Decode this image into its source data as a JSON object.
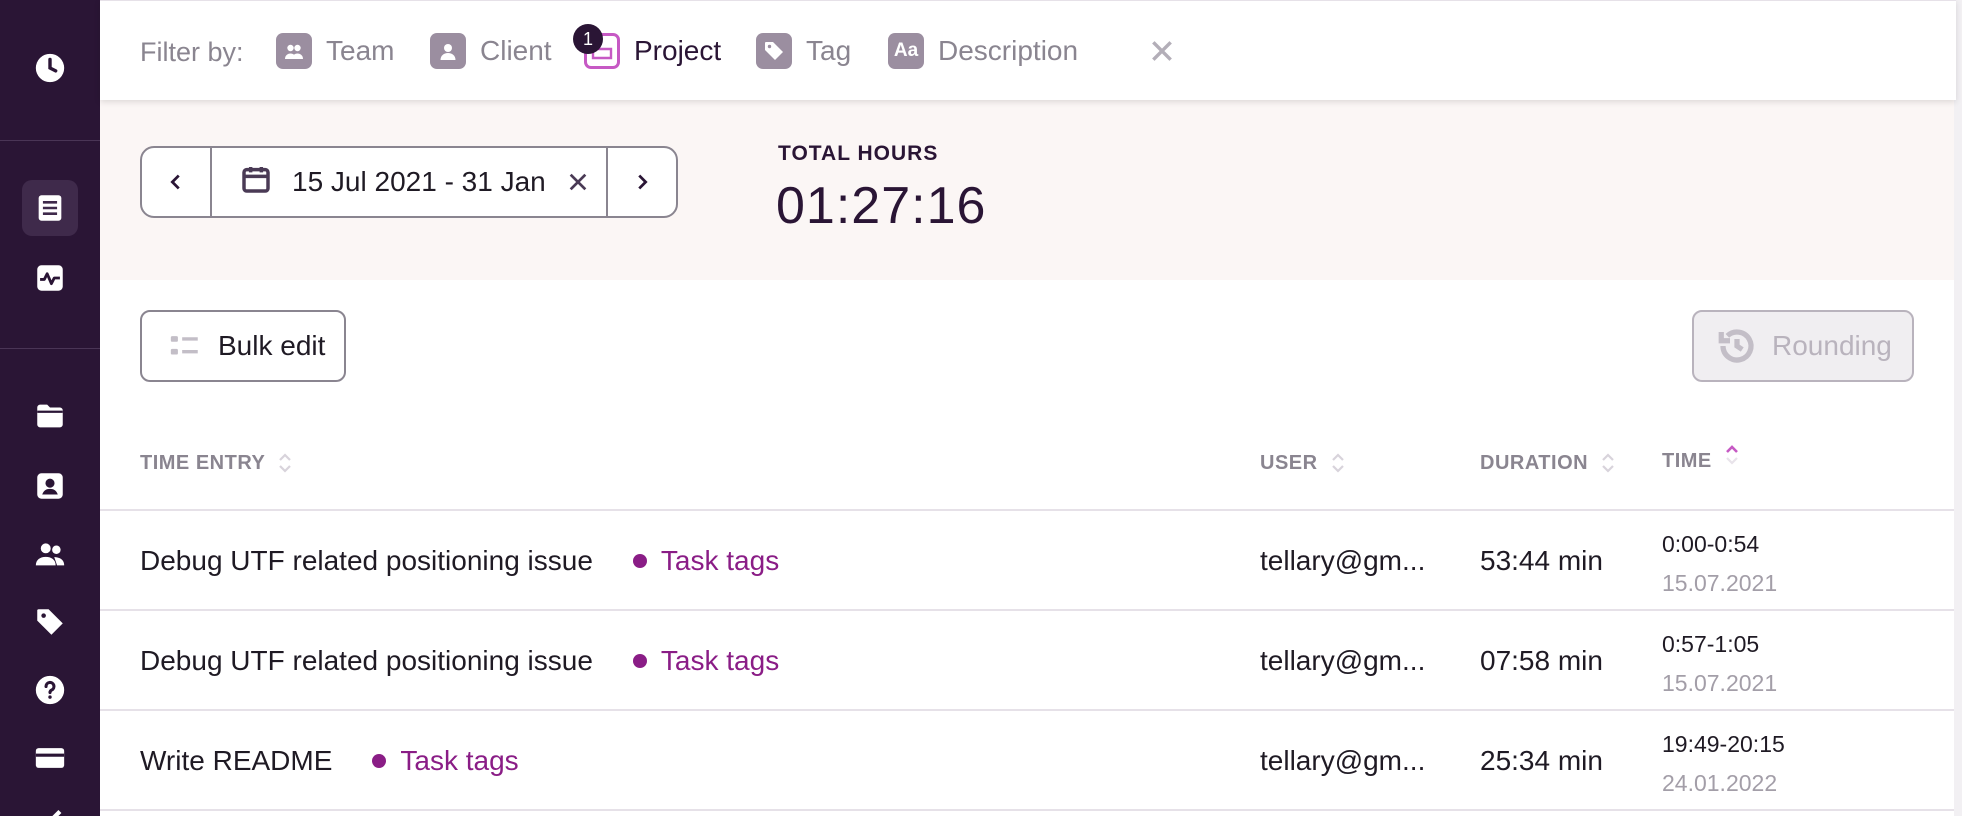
{
  "sidebar": {
    "items": [
      {
        "name": "clock-icon"
      },
      {
        "name": "timesheet-icon",
        "active": true
      },
      {
        "name": "activity-icon"
      },
      {
        "name": "folder-icon"
      },
      {
        "name": "client-icon"
      },
      {
        "name": "team-icon"
      },
      {
        "name": "tag-icon"
      },
      {
        "name": "help-icon"
      },
      {
        "name": "billing-icon"
      },
      {
        "name": "check-icon"
      }
    ]
  },
  "filters": {
    "label": "Filter by:",
    "items": [
      {
        "label": "Team",
        "icon": "team-icon",
        "active": false
      },
      {
        "label": "Client",
        "icon": "client-icon",
        "active": false
      },
      {
        "label": "Project",
        "icon": "project-icon",
        "active": true,
        "badge": "1"
      },
      {
        "label": "Tag",
        "icon": "tag-icon",
        "active": false
      },
      {
        "label": "Description",
        "icon": "description-icon",
        "active": false,
        "icon_text": "Aa"
      }
    ]
  },
  "date_range": {
    "text": "15 Jul 2021 - 31 Jan"
  },
  "summary": {
    "total_label": "TOTAL HOURS",
    "total_value": "01:27:16"
  },
  "actions": {
    "bulk_edit_label": "Bulk edit",
    "rounding_label": "Rounding"
  },
  "table": {
    "headers": {
      "entry": "TIME ENTRY",
      "user": "USER",
      "duration": "DURATION",
      "time": "TIME"
    },
    "rows": [
      {
        "description": "Debug UTF related positioning issue",
        "tag": "Task tags",
        "user": "tellary@gm...",
        "duration": "53:44 min",
        "time_range": "0:00-0:54",
        "date": "15.07.2021"
      },
      {
        "description": "Debug UTF related positioning issue",
        "tag": "Task tags",
        "user": "tellary@gm...",
        "duration": "07:58 min",
        "time_range": "0:57-1:05",
        "date": "15.07.2021"
      },
      {
        "description": "Write README",
        "tag": "Task tags",
        "user": "tellary@gm...",
        "duration": "25:34 min",
        "time_range": "19:49-20:15",
        "date": "24.01.2022"
      }
    ]
  },
  "colors": {
    "sidebar_bg": "#2a1535",
    "accent": "#c659c4",
    "tag_color": "#8a1d86",
    "summary_bg": "#fbf6f5"
  }
}
